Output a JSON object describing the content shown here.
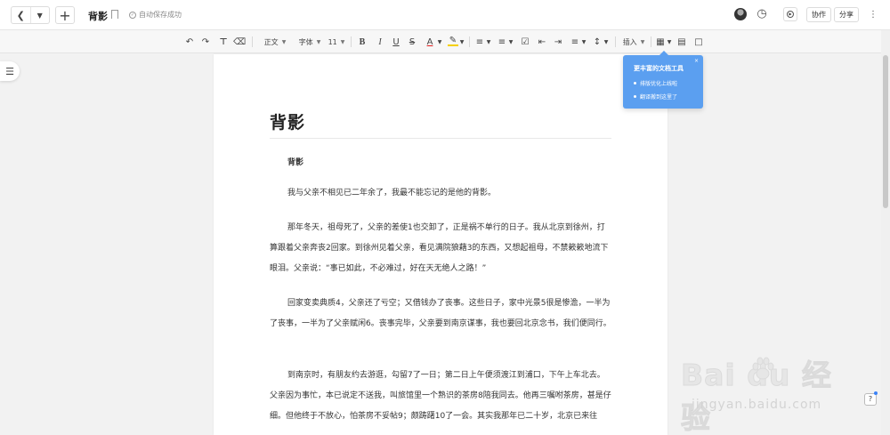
{
  "topbar": {
    "back_icon": "chevron-left-icon",
    "history_dropdown_icon": "caret-down-icon",
    "new_icon": "plus-icon",
    "doc_title": "背影",
    "autosave_text": "自动保存成功",
    "collab_label": "协作",
    "share_label": "分享",
    "more_icon": "vertical-dots-icon"
  },
  "toolbar": {
    "style_select": "正文",
    "font_select": "字体",
    "size_select": "11",
    "insert_label": "插入"
  },
  "document": {
    "title": "背影",
    "subtitle": "背影",
    "paragraphs": [
      "我与父亲不相见已二年余了，我最不能忘记的是他的背影。",
      "那年冬天，祖母死了，父亲的差使1也交卸了，正是祸不单行的日子。我从北京到徐州，打算跟着父亲奔丧2回家。到徐州见着父亲，看见满院狼藉3的东西，又想起祖母，不禁簌簌地流下眼泪。父亲说：“事已如此，不必难过，好在天无绝人之路！”",
      "回家变卖典质4，父亲还了亏空；又借钱办了丧事。这些日子，家中光景5很是惨澹，一半为了丧事，一半为了父亲赋闲6。丧事完毕，父亲要到南京谋事，我也要回北京念书，我们便同行。",
      "到南京时，有朋友约去游逛，勾留7了一日；第二日上午便须渡江到浦口，下午上车北去。父亲因为事忙，本已说定不送我，叫旅馆里一个熟识的茶房8陪我同去。他再三嘱咐茶房，甚是仔细。但他终于不放心，怕茶房不妥帖9；颇踌躇10了一会。其实我那年已二十岁，北京已来往"
    ]
  },
  "tip": {
    "title": "更丰富的文档工具",
    "items": [
      "排版优化上线啦",
      "翻译搬到这里了"
    ],
    "close": "×"
  },
  "help_label": "?",
  "watermark": {
    "brand": "Bai  du 经验",
    "url": "jingyan.baidu.com"
  }
}
